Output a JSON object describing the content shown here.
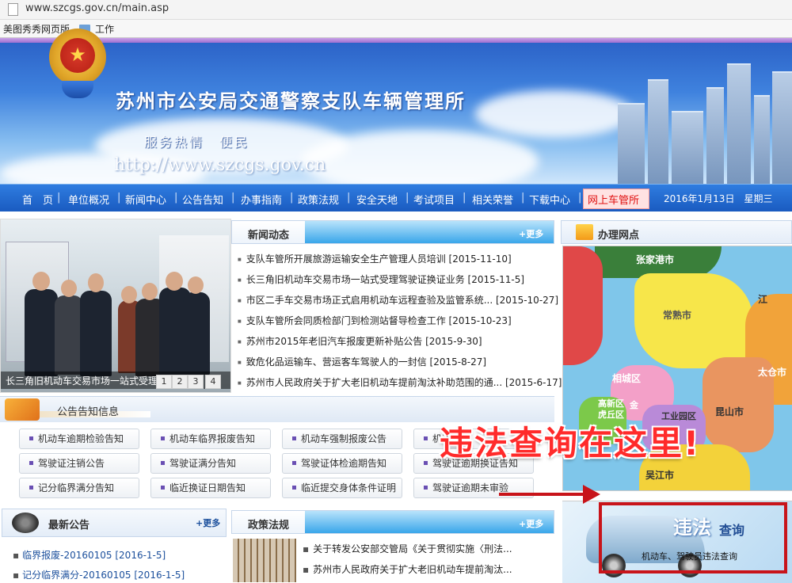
{
  "browser": {
    "url": "www.szcgs.gov.cn/main.asp",
    "bookmarks": [
      "美图秀秀网页版",
      "工作"
    ]
  },
  "banner": {
    "title": "苏州市公安局交通警察支队车辆管理所",
    "slogan": "服务热情　便民",
    "url_text": "http://www.szcgs.gov.cn"
  },
  "nav": {
    "items": [
      "首　页",
      "单位概况",
      "新闻中心",
      "公告告知",
      "办事指南",
      "政策法规",
      "安全天地",
      "考试项目",
      "相关荣誉",
      "下载中心",
      "网上车管所"
    ],
    "date": "2016年1月13日　星期三"
  },
  "slideshow": {
    "caption": "长三角旧机动车交易市场一站式受理驾",
    "pages": [
      "1",
      "2",
      "3",
      "4"
    ]
  },
  "news": {
    "title": "新闻动态",
    "more": "+更多",
    "items": [
      "支队车管所开展旅游运输安全生产管理人员培训 [2015-11-10]",
      "长三角旧机动车交易市场一站式受理驾驶证换证业务 [2015-11-5]",
      "市区二手车交易市场正式启用机动车远程查验及监管系统... [2015-10-27]",
      "支队车管所会同质检部门到检测站督导检查工作 [2015-10-23]",
      "苏州市2015年老旧汽车报废更新补贴公告 [2015-9-30]",
      "致危化品运输车、营运客车驾驶人的一封信 [2015-8-27]",
      "苏州市人民政府关于扩大老旧机动车提前淘汰补助范围的通... [2015-6-17]"
    ]
  },
  "offices": {
    "title": "办理网点"
  },
  "map": {
    "labels": [
      "张家港市",
      "常熟市",
      "太仓市",
      "昆山市",
      "相城区",
      "高新区",
      "虎丘区",
      "金",
      "工业园区",
      "吴江市",
      "江"
    ]
  },
  "notice": {
    "title": "公告告知信息",
    "buttons": [
      "机动车逾期检验告知",
      "机动车临界报废告知",
      "机动车强制报废公告",
      "机动车",
      "驾驶证注销公告",
      "驾驶证满分告知",
      "驾驶证体检逾期告知",
      "驾驶证逾期换证告知",
      "记分临界满分告知",
      "临近换证日期告知",
      "临近提交身体条件证明",
      "驾驶证逾期未审验"
    ]
  },
  "overlay": {
    "text": "违法查询在这里!"
  },
  "violation": {
    "big": "违法",
    "small": "查询",
    "sub": "机动车、驾驶员违法查询"
  },
  "latest": {
    "title": "最新公告",
    "more": "+更多",
    "items": [
      "临界报废-20160105 [2016-1-5]",
      "记分临界满分-20160105 [2016-1-5]"
    ]
  },
  "policy": {
    "title": "政策法规",
    "more": "+更多",
    "items": [
      "关于转发公安部交管局《关于贯彻实施〈刑法...",
      "苏州市人民政府关于扩大老旧机动车提前淘汰..."
    ]
  }
}
